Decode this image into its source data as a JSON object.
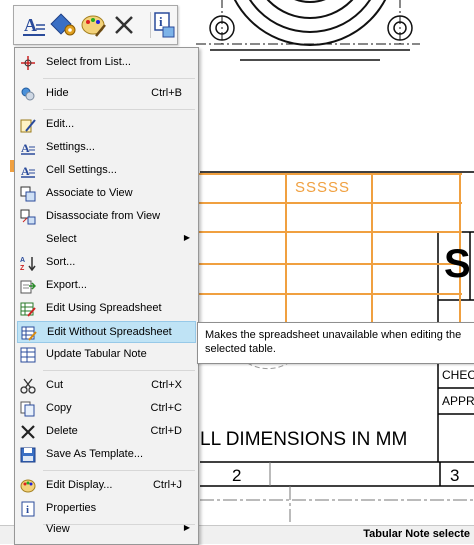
{
  "drawing": {
    "table_cell_text": "SSSSS",
    "dimensions_note": "LL DIMENSIONS IN MM",
    "zone_label_2": "2",
    "zone_label_3": "3",
    "title_block_letter": "S",
    "title_block_checked": "CHEC",
    "title_block_approved": "APPR"
  },
  "status_bar": {
    "text": "Tabular Note selecte"
  },
  "mini_toolbar": {
    "buttons": [
      {
        "icon": "note-text-icon"
      },
      {
        "icon": "settings-icon"
      },
      {
        "icon": "color-palette-icon"
      },
      {
        "icon": "delete-x-icon"
      },
      {
        "icon": "info-icon"
      }
    ]
  },
  "menu": {
    "items": [
      {
        "label": "Select from List...",
        "shortcut": "",
        "icon": "select-crosshair-icon"
      },
      {
        "label": "Hide",
        "shortcut": "Ctrl+B",
        "icon": "hide-icon"
      },
      {
        "label": "Edit...",
        "shortcut": "",
        "icon": "edit-icon"
      },
      {
        "label": "Settings...",
        "shortcut": "",
        "icon": "settings-text-icon"
      },
      {
        "label": "Cell Settings...",
        "shortcut": "",
        "icon": "cell-settings-icon"
      },
      {
        "label": "Associate to View",
        "shortcut": "",
        "icon": "associate-view-icon"
      },
      {
        "label": "Disassociate from View",
        "shortcut": "",
        "icon": "disassociate-view-icon"
      },
      {
        "label": "Select",
        "shortcut": "",
        "icon": ""
      },
      {
        "label": "Sort...",
        "shortcut": "",
        "icon": "sort-icon"
      },
      {
        "label": "Export...",
        "shortcut": "",
        "icon": "export-icon"
      },
      {
        "label": "Edit Using Spreadsheet",
        "shortcut": "",
        "icon": "spreadsheet-edit-icon"
      },
      {
        "label": "Edit Without Spreadsheet",
        "shortcut": "",
        "icon": "spreadsheet-no-edit-icon"
      },
      {
        "label": "Update Tabular Note",
        "shortcut": "",
        "icon": "update-note-icon"
      },
      {
        "label": "Cut",
        "shortcut": "Ctrl+X",
        "icon": "cut-icon"
      },
      {
        "label": "Copy",
        "shortcut": "Ctrl+C",
        "icon": "copy-icon"
      },
      {
        "label": "Delete",
        "shortcut": "Ctrl+D",
        "icon": "delete-icon"
      },
      {
        "label": "Save As Template...",
        "shortcut": "",
        "icon": "save-template-icon"
      },
      {
        "label": "Edit Display...",
        "shortcut": "Ctrl+J",
        "icon": "edit-display-icon"
      },
      {
        "label": "Properties",
        "shortcut": "",
        "icon": "properties-icon"
      },
      {
        "label": "View",
        "shortcut": "",
        "icon": ""
      }
    ]
  },
  "tooltip": {
    "text": "Makes the spreadsheet unavailable when editing the selected table."
  },
  "colors": {
    "table_orange": "#f0a040",
    "menu_highlight": "#bfe3f5",
    "menu_background": "#f2f2f2"
  }
}
